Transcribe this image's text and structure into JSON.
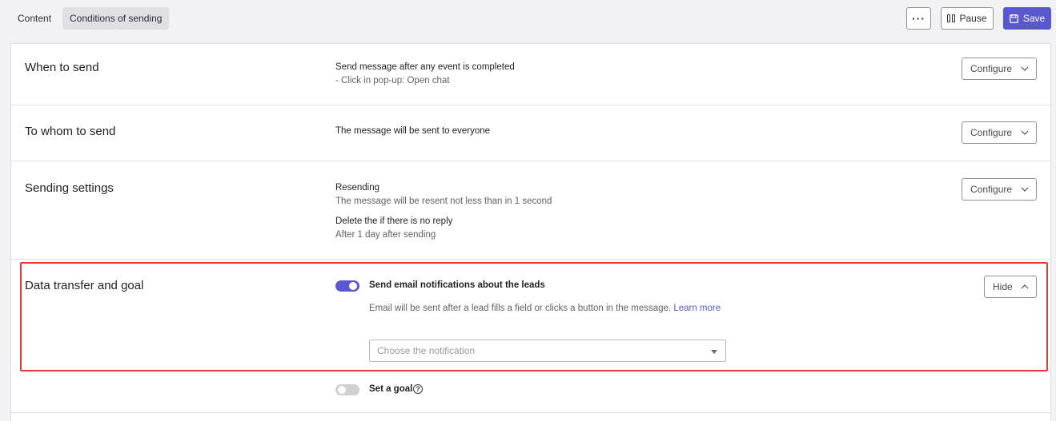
{
  "tabs": [
    {
      "label": "Content",
      "active": false
    },
    {
      "label": "Conditions of sending",
      "active": true
    }
  ],
  "toolbar": {
    "more_label": "···",
    "pause_label": "Pause",
    "save_label": "Save"
  },
  "colors": {
    "accent": "#5a58cf",
    "highlight_border": "#e53935",
    "toggle_off": "#cfcfd4"
  },
  "sections": {
    "when": {
      "title": "When to send",
      "line1": "Send message after any event is completed",
      "line2": "- Click in pop-up: Open chat",
      "button": "Configure"
    },
    "whom": {
      "title": "To whom to send",
      "line1": "The message will be sent to everyone",
      "button": "Configure"
    },
    "settings": {
      "title": "Sending settings",
      "resend_title": "Resending",
      "resend_desc": "The message will be resent not less than in 1 second",
      "delete_title": "Delete the if there is no reply",
      "delete_desc": "After 1 day after sending",
      "button": "Configure"
    },
    "data": {
      "title": "Data transfer and goal",
      "email_toggle_label": "Send email notifications about the leads",
      "email_toggle_on": true,
      "email_desc": "Email will be sent after a lead fills a field or clicks a button in the message.",
      "learn_more": "Learn more",
      "select_placeholder": "Choose the notification",
      "button": "Hide",
      "goal_toggle_label": "Set a goal",
      "goal_toggle_on": false
    }
  }
}
